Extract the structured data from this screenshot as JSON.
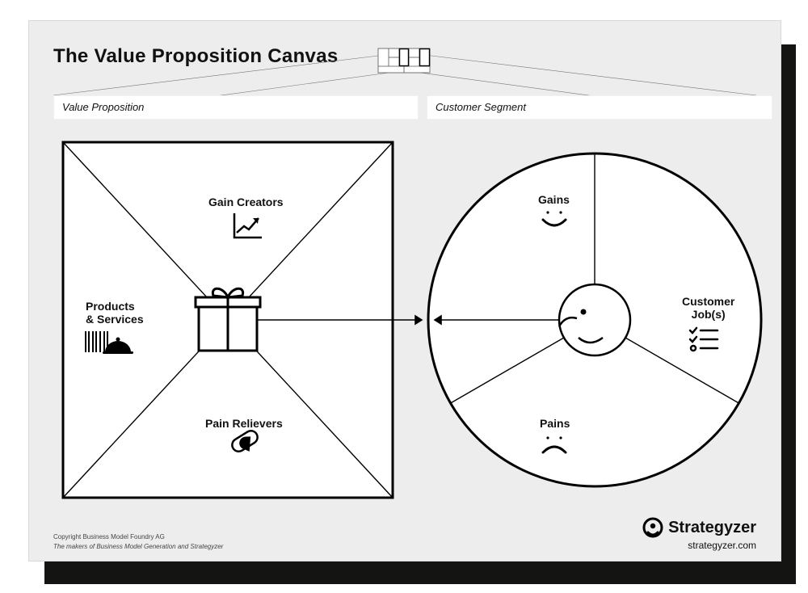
{
  "title": "The Value Proposition Canvas",
  "sections": {
    "vp_label": "Value Proposition",
    "cs_label": "Customer Segment"
  },
  "square": {
    "products_services": "Products\n& Services",
    "gain_creators": "Gain Creators",
    "pain_relievers": "Pain Relievers"
  },
  "circle": {
    "gains": "Gains",
    "pains": "Pains",
    "customer_jobs": "Customer\nJob(s)"
  },
  "footer": {
    "copyright_line1": "Copyright Business Model Foundry AG",
    "copyright_line2": "The makers of Business Model Generation and Strategyzer",
    "brand_name": "Strategyzer",
    "brand_url": "strategyzer.com"
  }
}
